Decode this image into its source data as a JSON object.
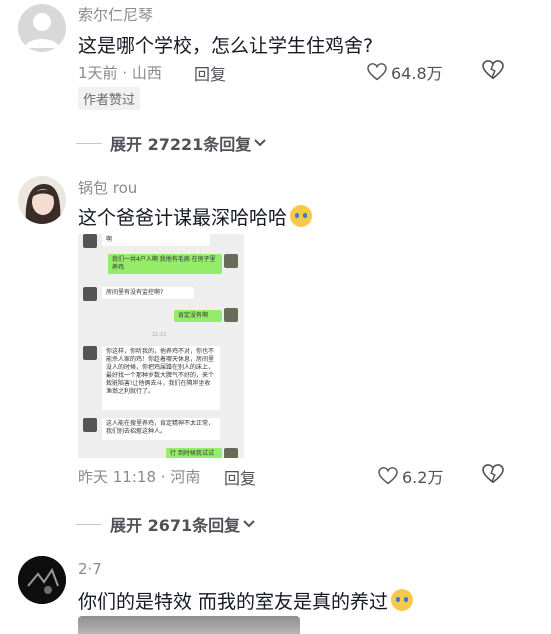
{
  "comments": [
    {
      "username": "索尔仁尼琴",
      "text": "这是哪个学校，怎么让学生住鸡舍?",
      "time": "1天前",
      "location": "山西",
      "reply_label": "回复",
      "likes": "64.8万",
      "badge": "作者赞过",
      "expand_prefix": "展开",
      "expand_count": "27221",
      "expand_suffix": "条回复"
    },
    {
      "username": "锅包 rou",
      "text": "这个爸爸计谋最深哈哈哈",
      "time": "昨天 11:18",
      "location": "河南",
      "reply_label": "回复",
      "likes": "6.2万",
      "expand_prefix": "展开",
      "expand_count": "2671",
      "expand_suffix": "条回复",
      "screenshot": {
        "msgs": [
          "啊",
          "我们一共4户人啊 我他有毛病 在房子里养鸡",
          "房间里有没有监控啊?",
          "肯定没有啊",
          "22:22",
          "你这样，你听我的，他养鸡不对，你也不能杀人家的鸡！你趁着哪天休息，房间里没人的时候，你把鸡屎蹭在别人的床上，最好找一个那种岁数大脾气不好的，来个栽赃陷害!让他俩去斗，我们在隔岸坐收渔翁之利就行了。",
          "这人能在搜里养鸡，肯定精神不太正常，我们别去招惹这种人。",
          "行 到时候我试试"
        ]
      }
    },
    {
      "username": "2·7",
      "text": "你们的是特效 而我的室友是真的养过"
    }
  ],
  "colors": {
    "text_primary": "#161823",
    "text_secondary": "#8a8b91",
    "bubble_green": "#95ec69"
  },
  "icons": [
    "heart-outline-icon",
    "broken-heart-icon",
    "chevron-down-icon",
    "laughing-crying-emoji",
    "crying-emoji"
  ]
}
